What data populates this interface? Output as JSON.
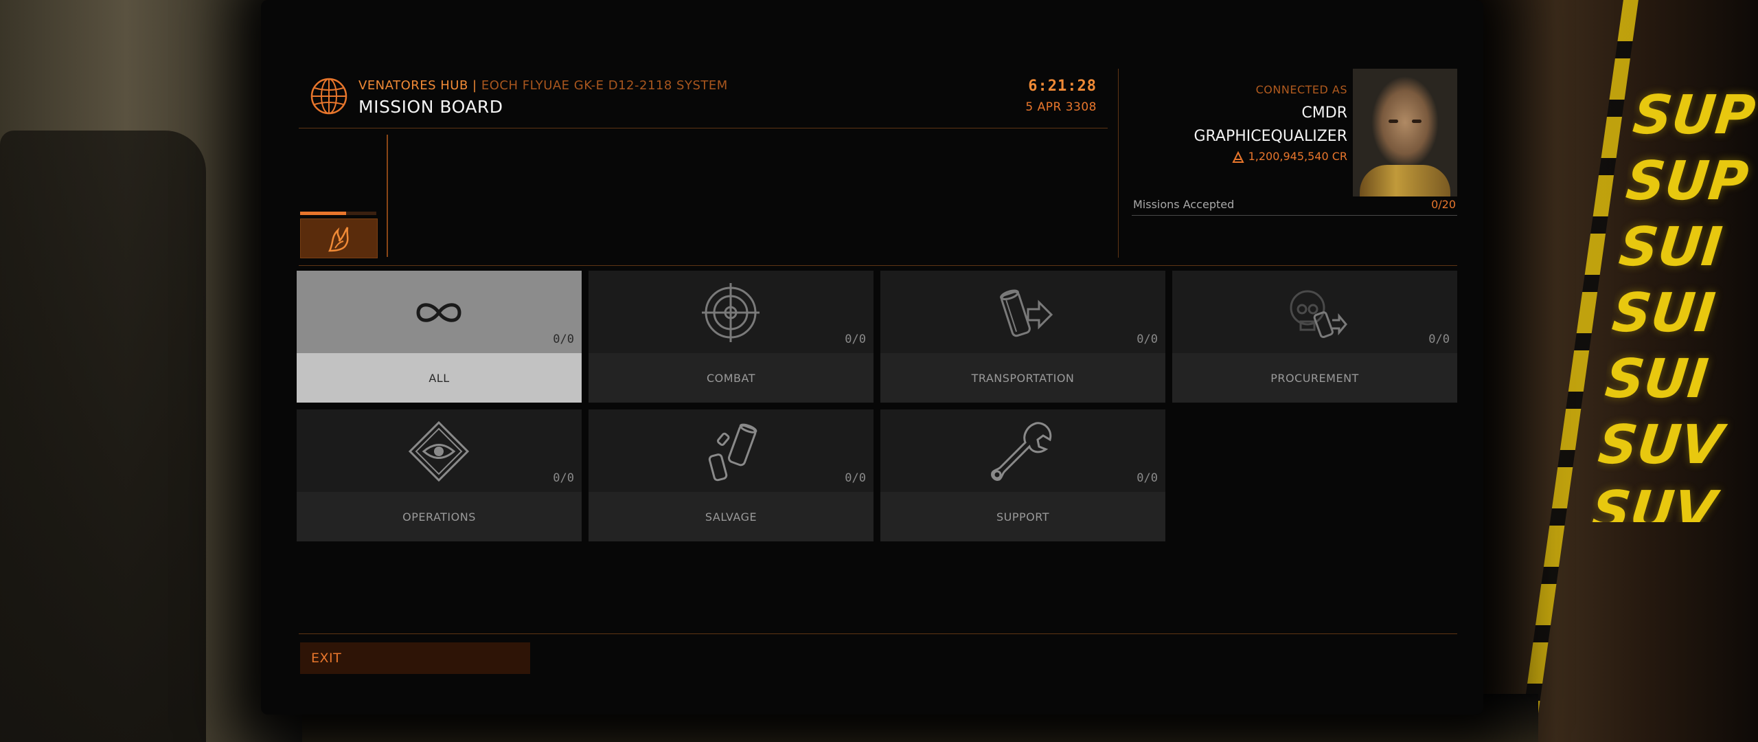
{
  "header": {
    "station_name": "VENATORES HUB",
    "separator": " | ",
    "system_name": "EOCH FLYUAE GK-E D12-2118 SYSTEM",
    "title": "MISSION BOARD",
    "time": "6:21:28",
    "date": "5 APR 3308"
  },
  "commander": {
    "connected_as": "CONNECTED AS",
    "cmdr_label": "CMDR",
    "name": "GRAPHICEQUALIZER",
    "credits": "1,200,945,540 CR",
    "missions_label": "Missions Accepted",
    "missions_count": "0/20"
  },
  "faction_tab": {
    "progress": 0.6,
    "icon": "faction-emblem-icon"
  },
  "categories": [
    {
      "label": "ALL",
      "count": "0/0",
      "icon": "infinity-icon",
      "selected": true
    },
    {
      "label": "COMBAT",
      "count": "0/0",
      "icon": "crosshair-icon",
      "selected": false
    },
    {
      "label": "TRANSPORTATION",
      "count": "0/0",
      "icon": "cargo-transport-icon",
      "selected": false
    },
    {
      "label": "PROCUREMENT",
      "count": "0/0",
      "icon": "skull-cargo-icon",
      "selected": false
    },
    {
      "label": "OPERATIONS",
      "count": "0/0",
      "icon": "eye-diamond-icon",
      "selected": false
    },
    {
      "label": "SALVAGE",
      "count": "0/0",
      "icon": "salvage-canisters-icon",
      "selected": false
    },
    {
      "label": "SUPPORT",
      "count": "0/0",
      "icon": "wrench-icon",
      "selected": false
    }
  ],
  "exit_label": "EXIT",
  "background_sign": "SUP SUP SUI SUI SUI SUV SUV",
  "colors": {
    "accent": "#e8762c",
    "accent_dark": "#5e3414",
    "panel": "#1b1b1b"
  }
}
